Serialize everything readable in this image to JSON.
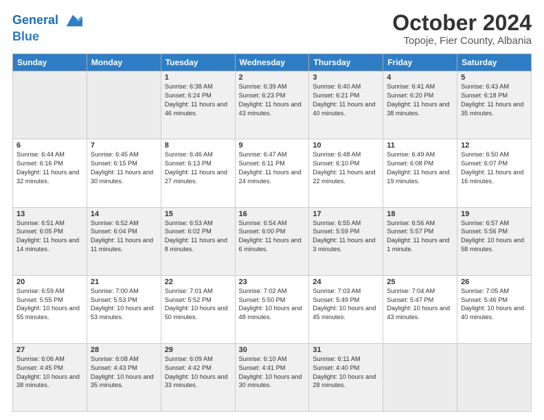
{
  "header": {
    "logo_line1": "General",
    "logo_line2": "Blue",
    "month": "October 2024",
    "location": "Topoje, Fier County, Albania"
  },
  "days_of_week": [
    "Sunday",
    "Monday",
    "Tuesday",
    "Wednesday",
    "Thursday",
    "Friday",
    "Saturday"
  ],
  "weeks": [
    [
      {
        "day": "",
        "detail": ""
      },
      {
        "day": "",
        "detail": ""
      },
      {
        "day": "1",
        "detail": "Sunrise: 6:38 AM\nSunset: 6:24 PM\nDaylight: 11 hours and 46 minutes."
      },
      {
        "day": "2",
        "detail": "Sunrise: 6:39 AM\nSunset: 6:23 PM\nDaylight: 11 hours and 43 minutes."
      },
      {
        "day": "3",
        "detail": "Sunrise: 6:40 AM\nSunset: 6:21 PM\nDaylight: 11 hours and 40 minutes."
      },
      {
        "day": "4",
        "detail": "Sunrise: 6:41 AM\nSunset: 6:20 PM\nDaylight: 11 hours and 38 minutes."
      },
      {
        "day": "5",
        "detail": "Sunrise: 6:43 AM\nSunset: 6:18 PM\nDaylight: 11 hours and 35 minutes."
      }
    ],
    [
      {
        "day": "6",
        "detail": "Sunrise: 6:44 AM\nSunset: 6:16 PM\nDaylight: 11 hours and 32 minutes."
      },
      {
        "day": "7",
        "detail": "Sunrise: 6:45 AM\nSunset: 6:15 PM\nDaylight: 11 hours and 30 minutes."
      },
      {
        "day": "8",
        "detail": "Sunrise: 6:46 AM\nSunset: 6:13 PM\nDaylight: 11 hours and 27 minutes."
      },
      {
        "day": "9",
        "detail": "Sunrise: 6:47 AM\nSunset: 6:11 PM\nDaylight: 11 hours and 24 minutes."
      },
      {
        "day": "10",
        "detail": "Sunrise: 6:48 AM\nSunset: 6:10 PM\nDaylight: 11 hours and 22 minutes."
      },
      {
        "day": "11",
        "detail": "Sunrise: 6:49 AM\nSunset: 6:08 PM\nDaylight: 11 hours and 19 minutes."
      },
      {
        "day": "12",
        "detail": "Sunrise: 6:50 AM\nSunset: 6:07 PM\nDaylight: 11 hours and 16 minutes."
      }
    ],
    [
      {
        "day": "13",
        "detail": "Sunrise: 6:51 AM\nSunset: 6:05 PM\nDaylight: 11 hours and 14 minutes."
      },
      {
        "day": "14",
        "detail": "Sunrise: 6:52 AM\nSunset: 6:04 PM\nDaylight: 11 hours and 11 minutes."
      },
      {
        "day": "15",
        "detail": "Sunrise: 6:53 AM\nSunset: 6:02 PM\nDaylight: 11 hours and 8 minutes."
      },
      {
        "day": "16",
        "detail": "Sunrise: 6:54 AM\nSunset: 6:00 PM\nDaylight: 11 hours and 6 minutes."
      },
      {
        "day": "17",
        "detail": "Sunrise: 6:55 AM\nSunset: 5:59 PM\nDaylight: 11 hours and 3 minutes."
      },
      {
        "day": "18",
        "detail": "Sunrise: 6:56 AM\nSunset: 5:57 PM\nDaylight: 11 hours and 1 minute."
      },
      {
        "day": "19",
        "detail": "Sunrise: 6:57 AM\nSunset: 5:56 PM\nDaylight: 10 hours and 58 minutes."
      }
    ],
    [
      {
        "day": "20",
        "detail": "Sunrise: 6:59 AM\nSunset: 5:55 PM\nDaylight: 10 hours and 55 minutes."
      },
      {
        "day": "21",
        "detail": "Sunrise: 7:00 AM\nSunset: 5:53 PM\nDaylight: 10 hours and 53 minutes."
      },
      {
        "day": "22",
        "detail": "Sunrise: 7:01 AM\nSunset: 5:52 PM\nDaylight: 10 hours and 50 minutes."
      },
      {
        "day": "23",
        "detail": "Sunrise: 7:02 AM\nSunset: 5:50 PM\nDaylight: 10 hours and 48 minutes."
      },
      {
        "day": "24",
        "detail": "Sunrise: 7:03 AM\nSunset: 5:49 PM\nDaylight: 10 hours and 45 minutes."
      },
      {
        "day": "25",
        "detail": "Sunrise: 7:04 AM\nSunset: 5:47 PM\nDaylight: 10 hours and 43 minutes."
      },
      {
        "day": "26",
        "detail": "Sunrise: 7:05 AM\nSunset: 5:46 PM\nDaylight: 10 hours and 40 minutes."
      }
    ],
    [
      {
        "day": "27",
        "detail": "Sunrise: 6:06 AM\nSunset: 4:45 PM\nDaylight: 10 hours and 38 minutes."
      },
      {
        "day": "28",
        "detail": "Sunrise: 6:08 AM\nSunset: 4:43 PM\nDaylight: 10 hours and 35 minutes."
      },
      {
        "day": "29",
        "detail": "Sunrise: 6:09 AM\nSunset: 4:42 PM\nDaylight: 10 hours and 33 minutes."
      },
      {
        "day": "30",
        "detail": "Sunrise: 6:10 AM\nSunset: 4:41 PM\nDaylight: 10 hours and 30 minutes."
      },
      {
        "day": "31",
        "detail": "Sunrise: 6:11 AM\nSunset: 4:40 PM\nDaylight: 10 hours and 28 minutes."
      },
      {
        "day": "",
        "detail": ""
      },
      {
        "day": "",
        "detail": ""
      }
    ]
  ]
}
